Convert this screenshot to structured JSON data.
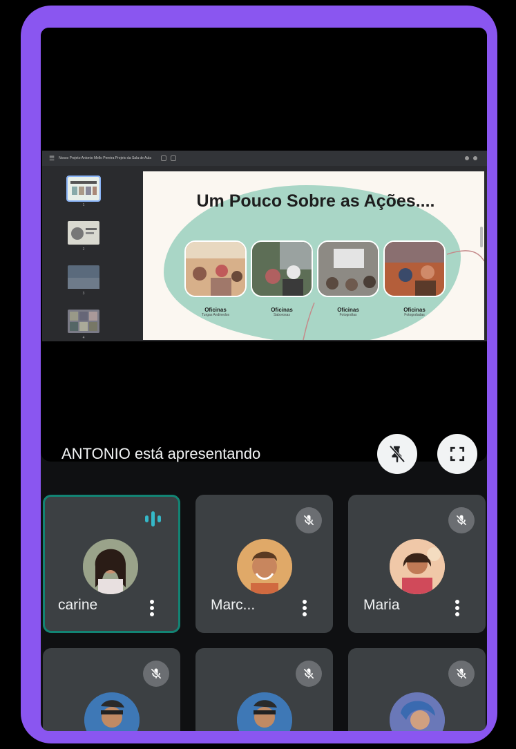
{
  "slides_app": {
    "menu_icon": "hamburger-icon",
    "document_title": "Nosso Projeto Antonio Mello Pereira Projeto da Sala de Aula",
    "thumbnails": [
      "1",
      "2",
      "3",
      "4"
    ]
  },
  "slide": {
    "title": "Um Pouco Sobre as Ações....",
    "captions": [
      {
        "title": "Oficinas",
        "subtitle": "Turgas Andinedos"
      },
      {
        "title": "Oficinas",
        "subtitle": "Saborosas"
      },
      {
        "title": "Oficinas",
        "subtitle": "Fotografias"
      },
      {
        "title": "Oficinas",
        "subtitle": "Fotografadas"
      }
    ]
  },
  "presentation": {
    "presenter_text": "ANTONIO está apresentando",
    "pin_icon": "unpin-icon",
    "fullscreen_icon": "fullscreen-icon"
  },
  "participants": [
    {
      "name": "carine",
      "state": "speaking",
      "indicator": "audio-level-icon"
    },
    {
      "name": "Marc...",
      "state": "muted",
      "indicator": "mic-off-icon"
    },
    {
      "name": "Maria",
      "state": "muted",
      "indicator": "mic-off-icon"
    },
    {
      "name": "",
      "state": "muted",
      "indicator": "mic-off-icon"
    },
    {
      "name": "",
      "state": "muted",
      "indicator": "mic-off-icon"
    },
    {
      "name": "",
      "state": "muted",
      "indicator": "mic-off-icon"
    }
  ],
  "colors": {
    "frame": "#8a56f0",
    "tile": "#3c4043",
    "speaking_outline": "#128474",
    "speaking_indicator": "#35b8c8",
    "slide_blob": "#a9d6c6"
  }
}
